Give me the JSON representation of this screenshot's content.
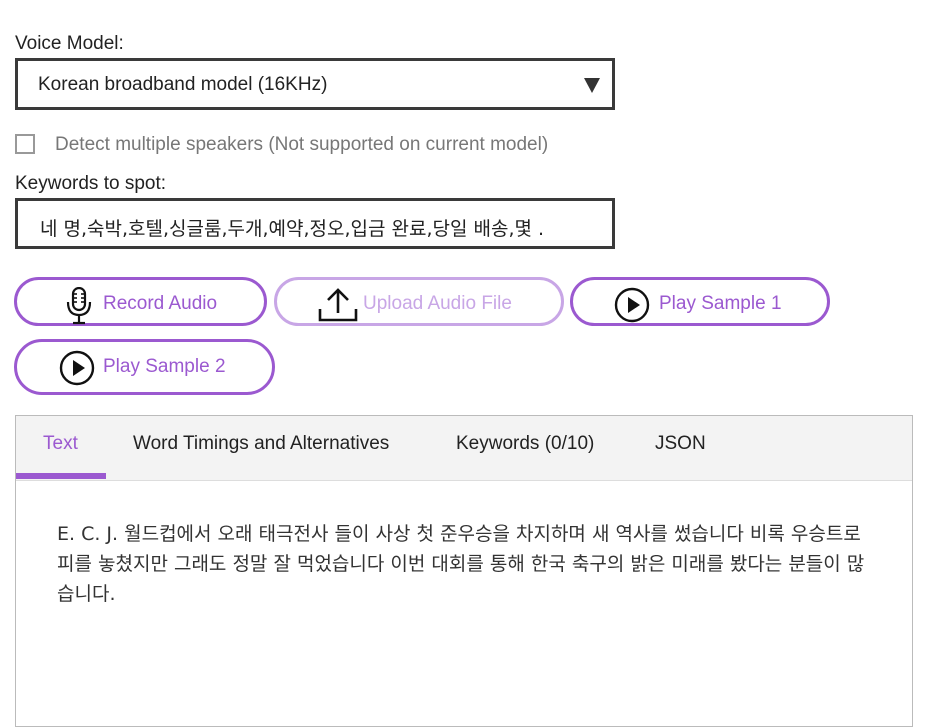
{
  "voice_model": {
    "label": "Voice Model:",
    "selected": "Korean broadband model (16KHz)"
  },
  "speakers": {
    "label": "Detect multiple speakers (Not supported on current model)",
    "checked": false
  },
  "keywords": {
    "label": "Keywords to spot:",
    "value": "네 명,숙박,호텔,싱글룸,두개,예약,정오,입금 완료,당일 배송,몇 ."
  },
  "buttons": {
    "record": "Record Audio",
    "upload": "Upload Audio File",
    "sample1": "Play Sample 1",
    "sample2": "Play Sample 2"
  },
  "tabs": [
    {
      "label": "Text",
      "active": true
    },
    {
      "label": "Word Timings and Alternatives",
      "active": false
    },
    {
      "label": "Keywords (0/10)",
      "active": false
    },
    {
      "label": "JSON",
      "active": false
    }
  ],
  "transcript": {
    "text": "E. C. J. 월드컵에서 오래 태극전사 들이 사상 첫 준우승을 차지하며 새 역사를 썼습니다 비록 우승트로피를 놓쳤지만 그래도 정말 잘 먹었습니다 이번 대회를 통해 한국 축구의 밝은 미래를 봤다는 분들이 많습니다."
  },
  "colors": {
    "accent": "#9b59d0",
    "accent_disabled": "#c8a6e6",
    "border": "#3a3a3a"
  },
  "icons": [
    "microphone-icon",
    "upload-icon",
    "play-icon",
    "chevron-down-icon"
  ]
}
